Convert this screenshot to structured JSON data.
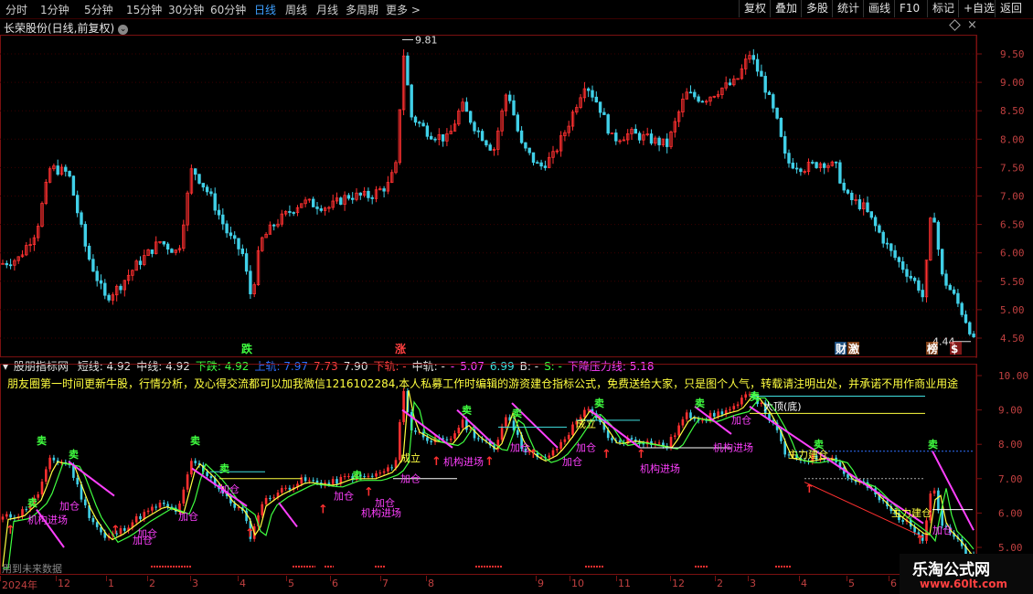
{
  "toolbar": {
    "timeframes": [
      "分时",
      "1分钟",
      "5分钟",
      "15分钟",
      "30分钟",
      "60分钟",
      "日线",
      "周线",
      "月线",
      "多周期",
      "更多 >"
    ],
    "active": "日线",
    "buttons": [
      "复权",
      "叠加",
      "多股",
      "统计",
      "画线",
      "F10",
      "标记",
      "+自选",
      "返回"
    ]
  },
  "main_chart": {
    "title": "长荣股份(日线,前复权)",
    "price_ticks": [
      "9.50",
      "9.00",
      "8.50",
      "8.00",
      "7.50",
      "7.00",
      "6.50",
      "6.00",
      "5.50",
      "5.00",
      "4.50"
    ],
    "high_label": "9.81",
    "low_label": "4.44",
    "markers": [
      "跌",
      "涨",
      "财",
      "激",
      "榜",
      "$"
    ]
  },
  "indicator": {
    "name": "股朋指标网",
    "fields": [
      {
        "label": "短线:",
        "value": "4.92",
        "color": "#e0e0e0"
      },
      {
        "label": "中线:",
        "value": "4.92",
        "color": "#e0e0e0"
      },
      {
        "label": "下跌:",
        "value": "4.92",
        "color": "#40ff40"
      },
      {
        "label": "上轨:",
        "value": "7.97",
        "color": "#3070ff"
      },
      {
        "label": "",
        "value": "7.73",
        "color": "#ff4040"
      },
      {
        "label": "",
        "value": "7.90",
        "color": "#e0e0e0"
      },
      {
        "label": "下轨:",
        "value": "-",
        "color": "#ff4040"
      },
      {
        "label": "中轨:",
        "value": "-",
        "color": "#e0e0e0"
      },
      {
        "label": "",
        "value": "-",
        "color": "#ff40ff"
      },
      {
        "label": "",
        "value": "5.07",
        "color": "#ff40ff"
      },
      {
        "label": "",
        "value": "6.99",
        "color": "#40e0e0"
      },
      {
        "label": "B:",
        "value": "-",
        "color": "#e0e0e0"
      },
      {
        "label": "S:",
        "value": "-",
        "color": "#40ff40"
      },
      {
        "label": "下降压力线:",
        "value": "5.18",
        "color": "#ff40ff"
      }
    ],
    "banner": "朋友圈第一时间更新牛股，行情分析，及心得交流都可以加我微信1216102284,本人私募工作时编辑的游资建仓指标公式，免费送给大家，只是图个人气，转载请注明出处，并承诺不用作商业用途",
    "ticks": [
      "10.00",
      "9.00",
      "8.00",
      "7.00",
      "6.00",
      "5.00"
    ],
    "signals": [
      "卖",
      "加仓",
      "机构进场",
      "成立",
      "主力建仓",
      "大底(底)",
      "买"
    ]
  },
  "footer": {
    "future_text": "用到未来数据",
    "months": [
      "2024年",
      "12",
      "1",
      "2",
      "3",
      "4",
      "5",
      "6",
      "7",
      "8",
      "9",
      "10",
      "11",
      "12",
      "2",
      "3",
      "4",
      "5",
      "6"
    ]
  },
  "watermark": {
    "title": "乐淘公式网",
    "url": "www.60lt.com"
  },
  "colors": {
    "up": "#ff3030",
    "down": "#40d0e8",
    "bg": "#000000",
    "axis": "#c04040"
  }
}
